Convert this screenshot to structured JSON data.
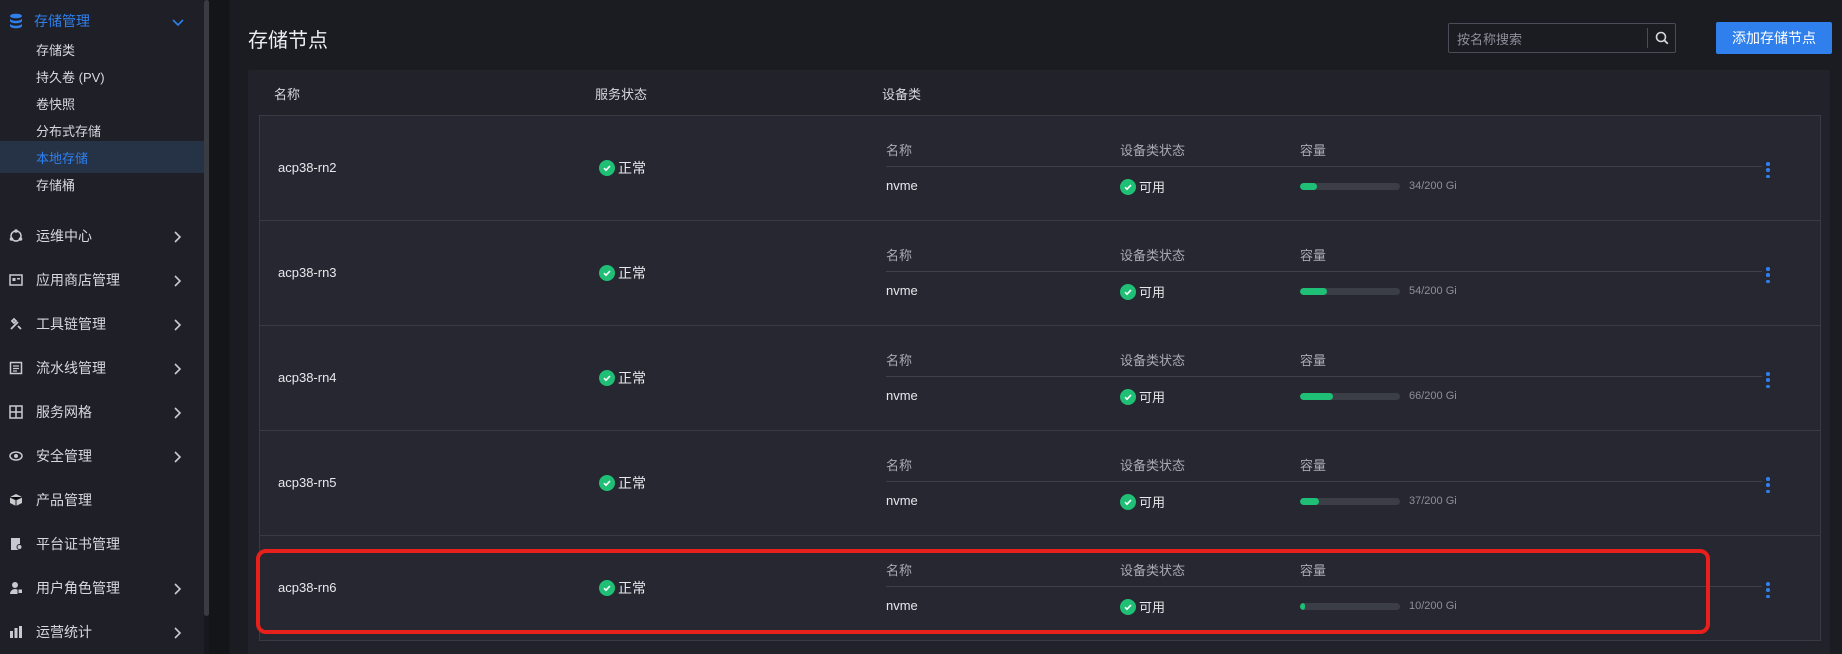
{
  "sidebar": {
    "group": {
      "label": "存储管理",
      "icon": "database-icon"
    },
    "sub_items": [
      "存储类",
      "持久卷 (PV)",
      "卷快照",
      "分布式存储",
      "本地存储",
      "存储桶"
    ],
    "active_sub": "本地存储",
    "items": [
      {
        "label": "运维中心",
        "icon": "operations-icon",
        "expandable": true
      },
      {
        "label": "应用商店管理",
        "icon": "app-store-icon",
        "expandable": true
      },
      {
        "label": "工具链管理",
        "icon": "tools-icon",
        "expandable": true
      },
      {
        "label": "流水线管理",
        "icon": "pipeline-icon",
        "expandable": true
      },
      {
        "label": "服务网格",
        "icon": "mesh-icon",
        "expandable": true
      },
      {
        "label": "安全管理",
        "icon": "security-icon",
        "expandable": true
      },
      {
        "label": "产品管理",
        "icon": "product-icon",
        "expandable": false
      },
      {
        "label": "平台证书管理",
        "icon": "certificate-icon",
        "expandable": false
      },
      {
        "label": "用户角色管理",
        "icon": "user-role-icon",
        "expandable": true
      },
      {
        "label": "运营统计",
        "icon": "stats-icon",
        "expandable": true
      }
    ]
  },
  "page": {
    "title": "存储节点",
    "search_placeholder": "按名称搜索",
    "add_button": "添加存储节点"
  },
  "table": {
    "headers": {
      "name": "名称",
      "service_status": "服务状态",
      "device_class": "设备类"
    },
    "sub_headers": {
      "name": "名称",
      "status": "设备类状态",
      "capacity": "容量"
    },
    "rows": [
      {
        "node": "acp38-rn2",
        "service_status": "正常",
        "device": "nvme",
        "device_status": "可用",
        "capacity": "34/200 Gi",
        "usage": 0.17
      },
      {
        "node": "acp38-rn3",
        "service_status": "正常",
        "device": "nvme",
        "device_status": "可用",
        "capacity": "54/200 Gi",
        "usage": 0.27
      },
      {
        "node": "acp38-rn4",
        "service_status": "正常",
        "device": "nvme",
        "device_status": "可用",
        "capacity": "66/200 Gi",
        "usage": 0.33
      },
      {
        "node": "acp38-rn5",
        "service_status": "正常",
        "device": "nvme",
        "device_status": "可用",
        "capacity": "37/200 Gi",
        "usage": 0.185
      },
      {
        "node": "acp38-rn6",
        "service_status": "正常",
        "device": "nvme",
        "device_status": "可用",
        "capacity": "10/200 Gi",
        "usage": 0.05
      }
    ]
  },
  "colors": {
    "accent": "#2f80ed",
    "success": "#1fbf76",
    "highlight": "#e8201c"
  }
}
